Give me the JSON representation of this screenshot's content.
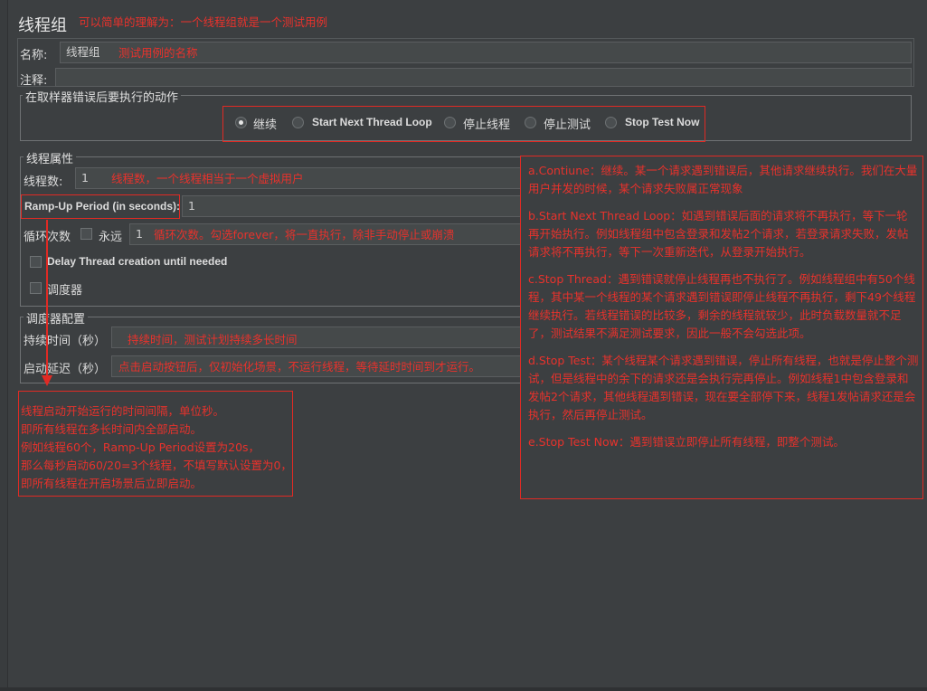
{
  "title": "线程组",
  "title_note": "可以简单的理解为：一个线程组就是一个测试用例",
  "name": {
    "label": "名称:",
    "value": "线程组",
    "note": "测试用例的名称"
  },
  "comment": {
    "label": "注释:",
    "value": ""
  },
  "sampler_error": {
    "title": "在取样器错误后要执行的动作",
    "options": [
      {
        "label": "继续",
        "selected": true
      },
      {
        "label": "Start Next Thread Loop",
        "selected": false
      },
      {
        "label": "停止线程",
        "selected": false
      },
      {
        "label": "停止测试",
        "selected": false
      },
      {
        "label": "Stop Test Now",
        "selected": false
      }
    ]
  },
  "thread_props": {
    "title": "线程属性",
    "threads": {
      "label": "线程数:",
      "value": "1",
      "note": "线程数，一个线程相当于一个虚拟用户"
    },
    "rampup": {
      "label": "Ramp-Up Period (in seconds):",
      "value": "1"
    },
    "loop": {
      "label": "循环次数",
      "forever_label": "永远",
      "value": "1",
      "note": "循环次数。勾选forever，将一直执行，除非手动停止或崩溃"
    },
    "delay_label": "Delay Thread creation until needed",
    "scheduler_label": "调度器"
  },
  "scheduler_config": {
    "title": "调度器配置",
    "duration": {
      "label": "持续时间（秒）",
      "note": "持续时间，测试计划持续多长时间"
    },
    "delay": {
      "label": "启动延迟（秒）",
      "note": "点击启动按钮后，仅初始化场景，不运行线程，等待延时时间到才运行。"
    }
  },
  "rampup_note": [
    "线程启动开始运行的时间间隔，单位秒。",
    "即所有线程在多长时间内全部启动。",
    "例如线程60个，Ramp-Up Period设置为20s，",
    "那么每秒启动60/20=3个线程，不填写默认设置为0，",
    "即所有线程在开启场景后立即启动。"
  ],
  "error_notes": [
    "a.Contiune：继续。某一个请求遇到错误后，其他请求继续执行。我们在大量用户并发的时候，某个请求失败属正常现象",
    "b.Start Next Thread Loop：如遇到错误后面的请求将不再执行，等下一轮再开始执行。例如线程组中包含登录和发帖2个请求，若登录请求失败，发帖请求将不再执行，等下一次重新迭代，从登录开始执行。",
    "c.Stop Thread：遇到错误就停止线程再也不执行了。例如线程组中有50个线程，其中某一个线程的某个请求遇到错误即停止线程不再执行，剩下49个线程继续执行。若线程错误的比较多，剩余的线程就较少，此时负载数量就不足了，测试结果不满足测试要求，因此一般不会勾选此项。",
    "d.Stop Test：某个线程某个请求遇到错误，停止所有线程，也就是停止整个测试，但是线程中的余下的请求还是会执行完再停止。例如线程1中包含登录和发帖2个请求，其他线程遇到错误，现在要全部停下来，线程1发帖请求还是会执行，然后再停止测试。",
    "e.Stop Test Now：遇到错误立即停止所有线程，即整个测试。"
  ],
  "colors": {
    "annotation": "#e8322c",
    "background": "#3c3f41"
  }
}
